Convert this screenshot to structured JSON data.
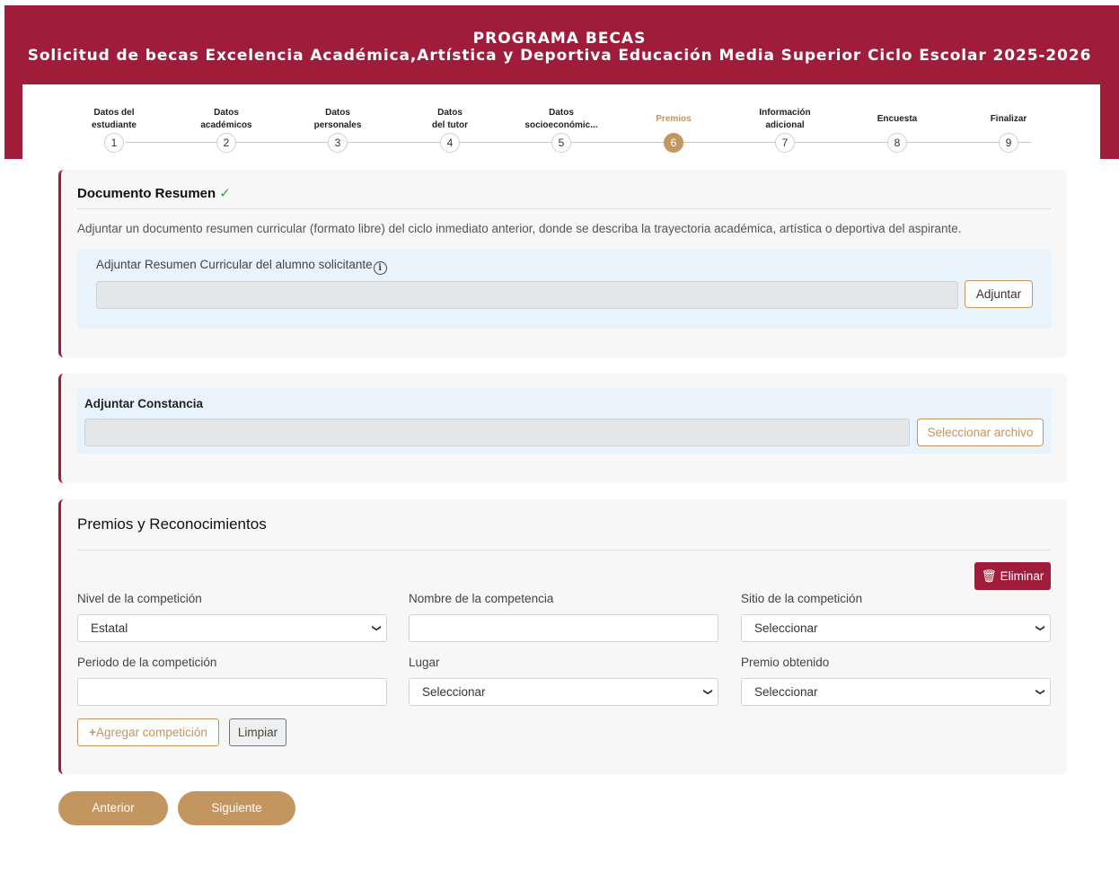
{
  "header": {
    "title": "PROGRAMA BECAS",
    "subtitle": "Solicitud de becas Excelencia Académica,Artística y Deportiva Educación Media Superior Ciclo Escolar 2025-2026"
  },
  "stepper": {
    "steps": [
      {
        "label_line1": "Datos del",
        "label_line2": "estudiante",
        "num": "1"
      },
      {
        "label_line1": "Datos",
        "label_line2": "académicos",
        "num": "2"
      },
      {
        "label_line1": "Datos",
        "label_line2": "personales",
        "num": "3"
      },
      {
        "label_line1": "Datos",
        "label_line2": "del tutor",
        "num": "4"
      },
      {
        "label_line1": "Datos",
        "label_line2": "socioeconómic...",
        "num": "5"
      },
      {
        "label_line1": "Premios",
        "label_line2": "",
        "num": "6"
      },
      {
        "label_line1": "Información",
        "label_line2": "adicional",
        "num": "7"
      },
      {
        "label_line1": "Encuesta",
        "label_line2": "",
        "num": "8"
      },
      {
        "label_line1": "Finalizar",
        "label_line2": "",
        "num": "9"
      }
    ],
    "active_step": 6
  },
  "resumen": {
    "title": "Documento Resumen",
    "check": "✓",
    "description": "Adjuntar un documento resumen curricular (formato libre) del ciclo inmediato anterior, donde se describa la trayectoria académica, artística o deportiva del aspirante.",
    "upload_label": "Adjuntar Resumen Curricular del alumno solicitante",
    "info_icon": "i",
    "button": "Adjuntar"
  },
  "constancia": {
    "title": "Adjuntar Constancia",
    "button": "Seleccionar archivo"
  },
  "premios": {
    "heading": "Premios y Reconocimientos",
    "delete_button": "Eliminar",
    "fields": {
      "nivel_label": "Nivel de la competición",
      "nivel_value": "Estatal",
      "nombre_label": "Nombre de la competencia",
      "nombre_value": "",
      "sitio_label": "Sitio de la competición",
      "sitio_value": "Seleccionar",
      "periodo_label": "Periodo de la competición",
      "periodo_value": "",
      "lugar_label": "Lugar",
      "lugar_value": "Seleccionar",
      "premio_label": "Premio obtenido",
      "premio_value": "Seleccionar"
    },
    "add_button": "Agregar competición",
    "clear_button": "Limpiar"
  },
  "nav": {
    "prev": "Anterior",
    "next": "Siguiente"
  },
  "colors": {
    "brand": "#a01c3b",
    "accent": "#c3955f"
  }
}
